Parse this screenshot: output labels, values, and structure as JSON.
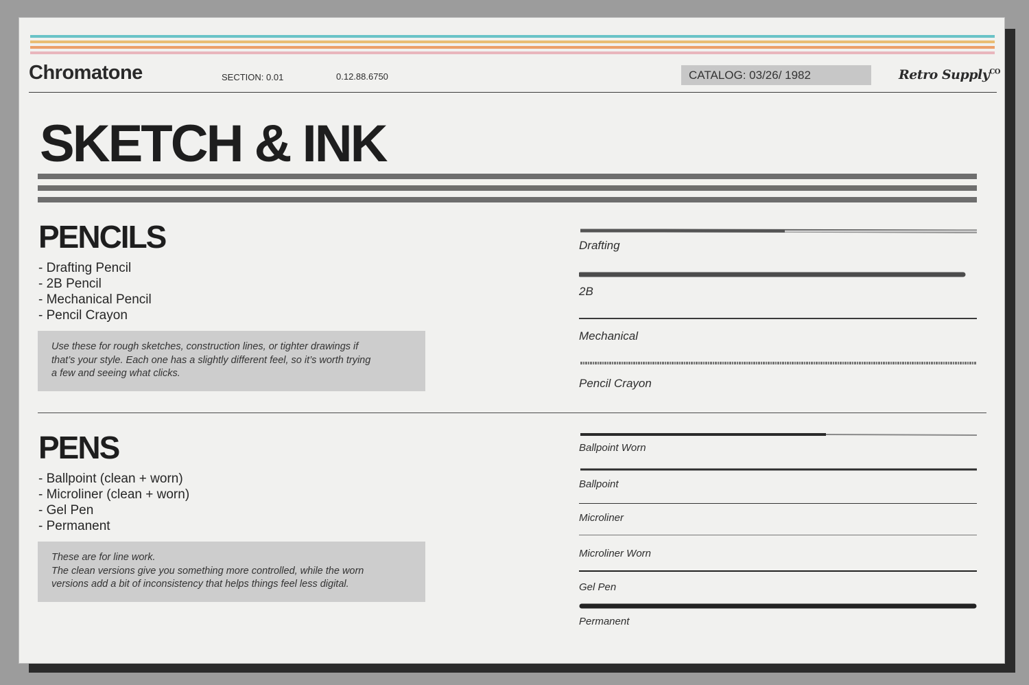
{
  "header": {
    "brand": "Chromatone",
    "section": "SECTION: 0.01",
    "code": "0.12.88.6750",
    "catalog": "CATALOG: 03/26/ 1982",
    "logo": "Retro Supply",
    "logo_suffix": "CO"
  },
  "stripe_colors": [
    "#6ac3c7",
    "#e9bd73",
    "#ec9f6a",
    "#e8b6bd"
  ],
  "title": "SKETCH & INK",
  "pencils": {
    "heading": "PENCILS",
    "items": [
      "- Drafting Pencil",
      "- 2B Pencil",
      "- Mechanical Pencil",
      "- Pencil Crayon"
    ],
    "description": "Use these for rough sketches, construction lines, or tighter drawings if\nthat’s your style. Each one has a slightly different feel, so it’s worth trying\na few and seeing what clicks.",
    "samples": [
      "Drafting",
      "2B",
      "Mechanical",
      "Pencil Crayon"
    ]
  },
  "pens": {
    "heading": "PENS",
    "items": [
      "- Ballpoint (clean + worn)",
      "- Microliner (clean + worn)",
      "- Gel Pen",
      "- Permanent"
    ],
    "description": "These are for line work.\nThe clean versions give you something more controlled, while the worn\nversions add a bit of inconsistency that helps things feel less digital.",
    "samples": [
      "Ballpoint Worn",
      "Ballpoint",
      "Microliner",
      "Microliner Worn",
      "Gel Pen",
      "Permanent"
    ]
  }
}
